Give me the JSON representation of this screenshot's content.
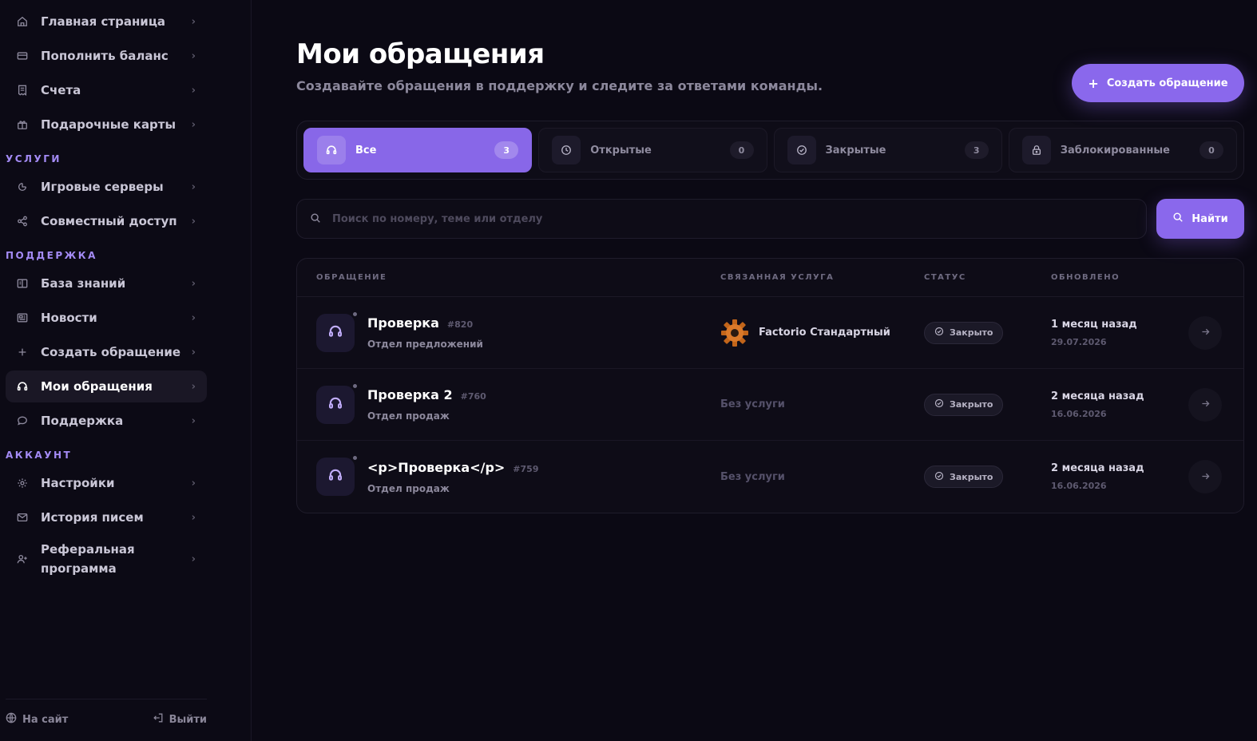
{
  "sidebar": {
    "top_items": [
      {
        "label": "Главная страница",
        "icon": "home-icon"
      },
      {
        "label": "Пополнить баланс",
        "icon": "credit-card-icon"
      },
      {
        "label": "Счета",
        "icon": "receipt-icon"
      },
      {
        "label": "Подарочные карты",
        "icon": "gift-icon"
      }
    ],
    "sections": {
      "services": {
        "label": "УСЛУГИ",
        "items": [
          {
            "label": "Игровые серверы",
            "icon": "gamepad-icon"
          },
          {
            "label": "Совместный доступ",
            "icon": "share-icon"
          }
        ]
      },
      "support": {
        "label": "ПОДДЕРЖКА",
        "items": [
          {
            "label": "База знаний",
            "icon": "book-icon"
          },
          {
            "label": "Новости",
            "icon": "newspaper-icon"
          },
          {
            "label": "Создать обращение",
            "icon": "plus-icon"
          },
          {
            "label": "Мои обращения",
            "icon": "headphones-icon",
            "active": true
          },
          {
            "label": "Поддержка",
            "icon": "chat-bubble-icon"
          }
        ]
      },
      "account": {
        "label": "АККАУНТ",
        "items": [
          {
            "label": "Настройки",
            "icon": "gear-icon"
          },
          {
            "label": "История писем",
            "icon": "mail-icon"
          },
          {
            "label": "Реферальная программа",
            "icon": "user-plus-icon"
          }
        ]
      }
    },
    "footer": {
      "site_label": "На сайт",
      "logout_label": "Выйти"
    }
  },
  "header": {
    "title": "Мои обращения",
    "subtitle": "Создавайте обращения в поддержку и следите за ответами команды.",
    "create_button_label": "Создать обращение"
  },
  "tabs": [
    {
      "label": "Все",
      "count": "3",
      "icon": "headphones-icon",
      "active": true
    },
    {
      "label": "Открытые",
      "count": "0",
      "icon": "clock-icon"
    },
    {
      "label": "Закрытые",
      "count": "3",
      "icon": "check-circle-icon"
    },
    {
      "label": "Заблокированные",
      "count": "0",
      "icon": "lock-icon"
    }
  ],
  "search": {
    "placeholder": "Поиск по номеру, теме или отделу",
    "value": "",
    "button_label": "Найти"
  },
  "table": {
    "columns": [
      "ОБРАЩЕНИЕ",
      "СВЯЗАННАЯ УСЛУГА",
      "СТАТУС",
      "ОБНОВЛЕНО"
    ],
    "rows": [
      {
        "title": "Проверка",
        "number": "#820",
        "department": "Отдел предложений",
        "service": "Factorio Стандартный",
        "service_icon": "factorio-gear-icon",
        "status": "Закрыто",
        "updated_relative": "1 месяц назад",
        "updated_date": "29.07.2026"
      },
      {
        "title": "Проверка 2",
        "number": "#760",
        "department": "Отдел продаж",
        "service": "Без услуги",
        "status": "Закрыто",
        "updated_relative": "2 месяца назад",
        "updated_date": "16.06.2026"
      },
      {
        "title": "<p>Проверка</p>",
        "number": "#759",
        "department": "Отдел продаж",
        "service": "Без услуги",
        "status": "Закрыто",
        "updated_relative": "2 месяца назад",
        "updated_date": "16.06.2026"
      }
    ]
  },
  "colors": {
    "accent": "#8a68ec",
    "section_label": "#a48bf5",
    "background": "#0b0914"
  }
}
